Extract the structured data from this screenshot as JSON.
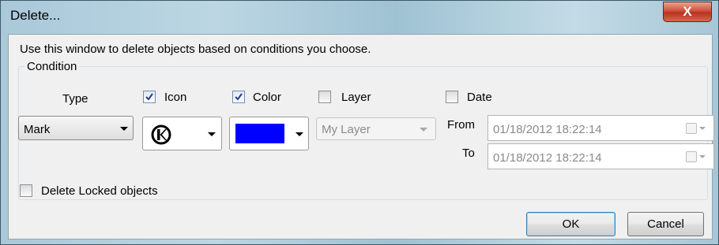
{
  "window": {
    "title": "Delete...",
    "close_label": "X"
  },
  "description": "Use this window to delete objects based on conditions you choose.",
  "condition": {
    "legend": "Condition",
    "type": {
      "label": "Type",
      "value": "Mark"
    },
    "icon": {
      "label": "Icon",
      "checked": true,
      "value_icon": "k-circle-icon"
    },
    "color": {
      "label": "Color",
      "checked": true,
      "value_color": "#0000ff"
    },
    "layer": {
      "label": "Layer",
      "checked": false,
      "value": "My Layer"
    },
    "date": {
      "label": "Date",
      "checked": false,
      "from_label": "From",
      "from_value": "01/18/2012 18:22:14",
      "to_label": "To",
      "to_value": "01/18/2012 18:22:14"
    }
  },
  "delete_locked": {
    "label": "Delete Locked objects",
    "checked": false
  },
  "buttons": {
    "ok": "OK",
    "cancel": "Cancel"
  }
}
